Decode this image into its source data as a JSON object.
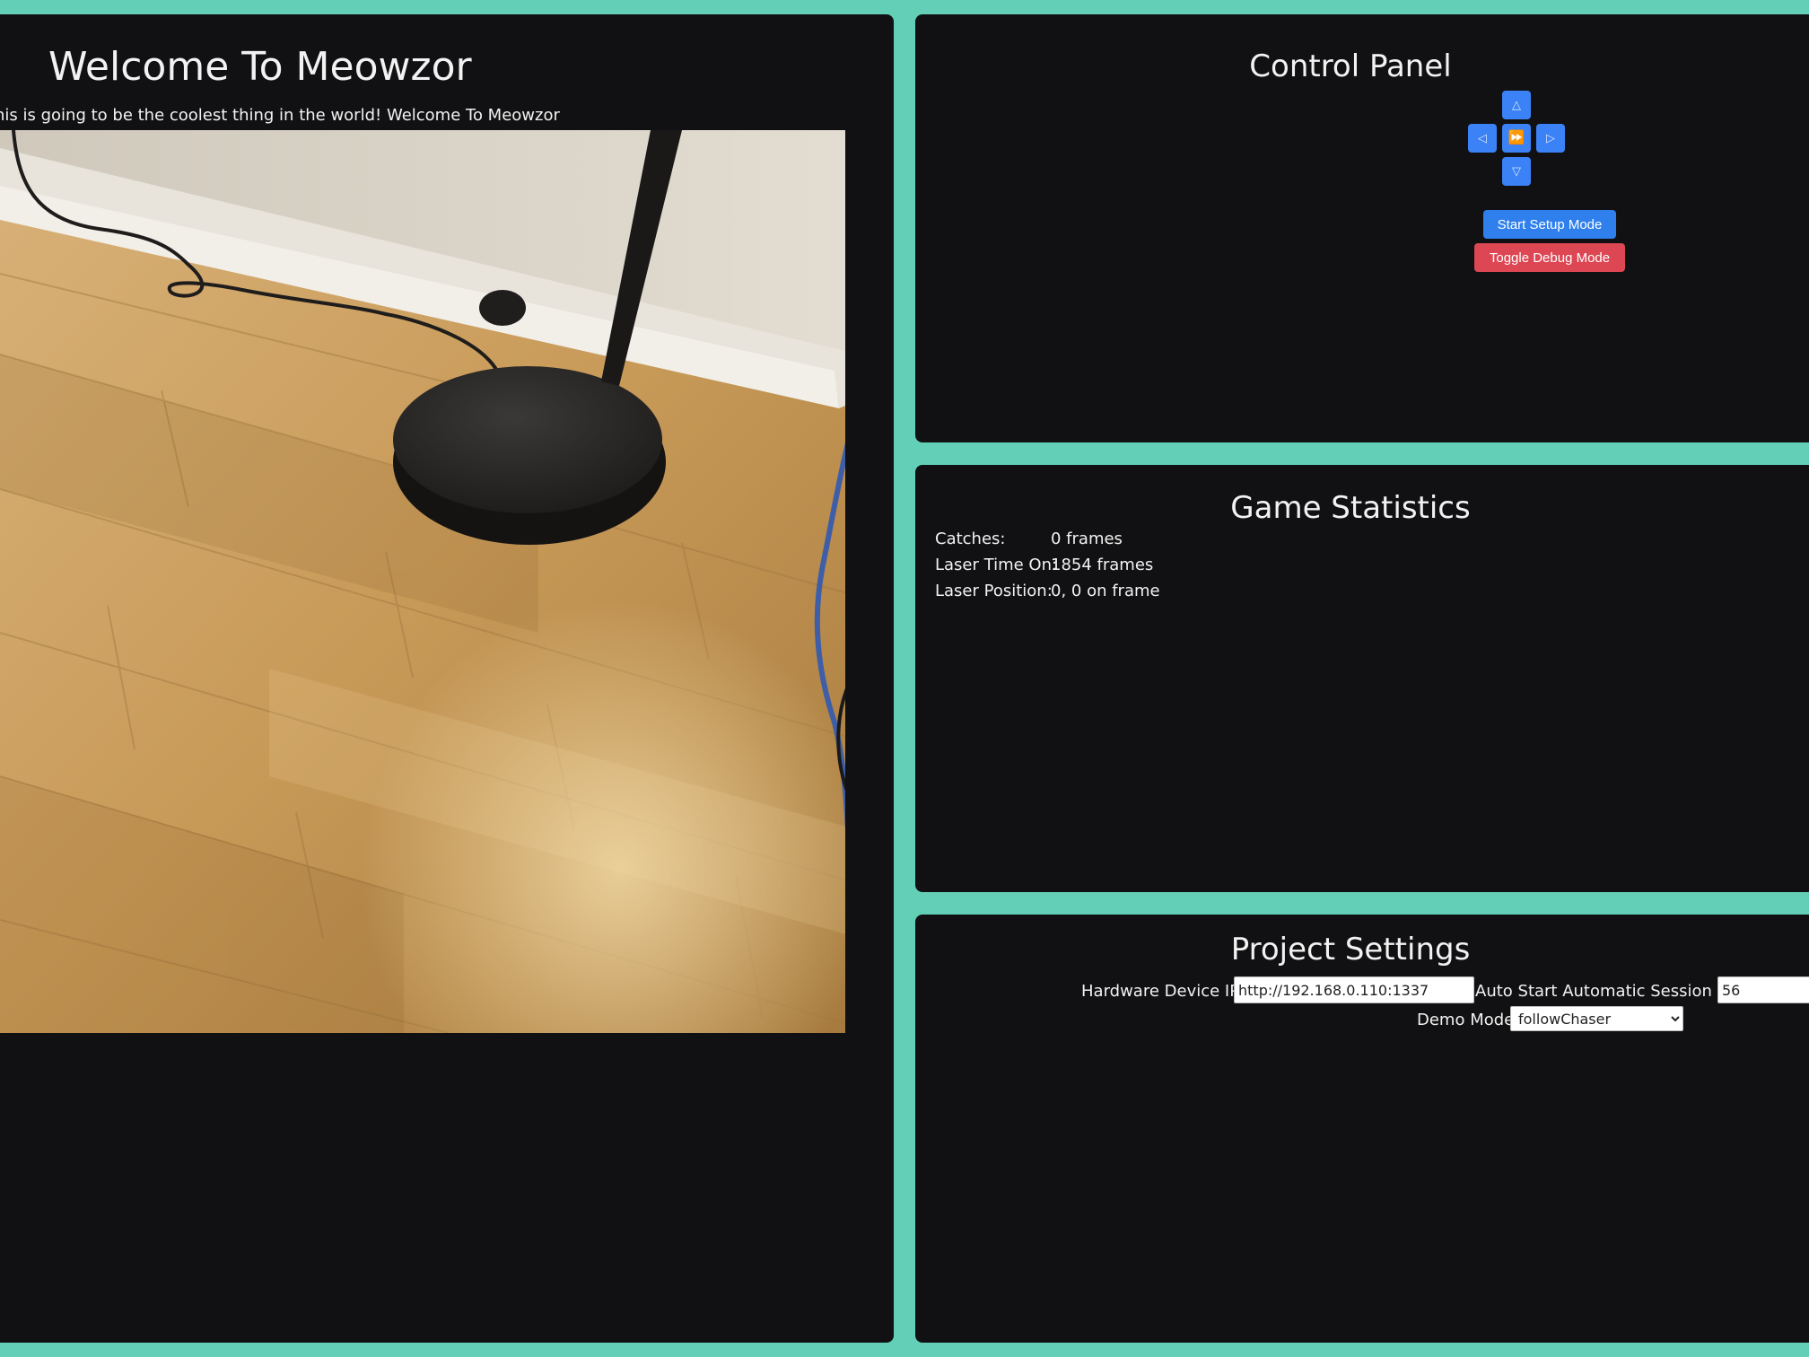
{
  "header": {
    "title": "Welcome To Meowzor",
    "subtitle": "his is going to be the coolest thing in the world! Welcome To Meowzor"
  },
  "camera": {
    "icon": "camera-feed-image"
  },
  "control_panel": {
    "title": "Control Panel",
    "up_glyph": "△",
    "left_glyph": "◁",
    "center_glyph": "⏩",
    "right_glyph": "▷",
    "down_glyph": "▽",
    "setup_button": "Start Setup Mode",
    "debug_button": "Toggle Debug Mode",
    "colors": {
      "dpad": "#3b82f6",
      "setup": "#2f80ed",
      "debug": "#dc4753"
    }
  },
  "stats": {
    "title": "Game Statistics",
    "items": [
      {
        "label": "Catches:",
        "value": "0 frames"
      },
      {
        "label": "Laser Time On:",
        "value": "1854 frames"
      },
      {
        "label": "Laser Position:",
        "value": "0, 0 on frame"
      }
    ]
  },
  "settings": {
    "title": "Project Settings",
    "hardware_ip_label": "Hardware Device IP:",
    "hardware_ip_value": "http://192.168.0.110:1337",
    "auto_start_label": "Auto Start Automatic Session in:",
    "auto_start_value": "56",
    "demo_mode_label": "Demo Mode",
    "demo_mode_value": "followChaser",
    "demo_mode_options": [
      "followChaser"
    ]
  },
  "theme": {
    "background_accent": "#62cfb6",
    "panel_background": "#111113"
  }
}
